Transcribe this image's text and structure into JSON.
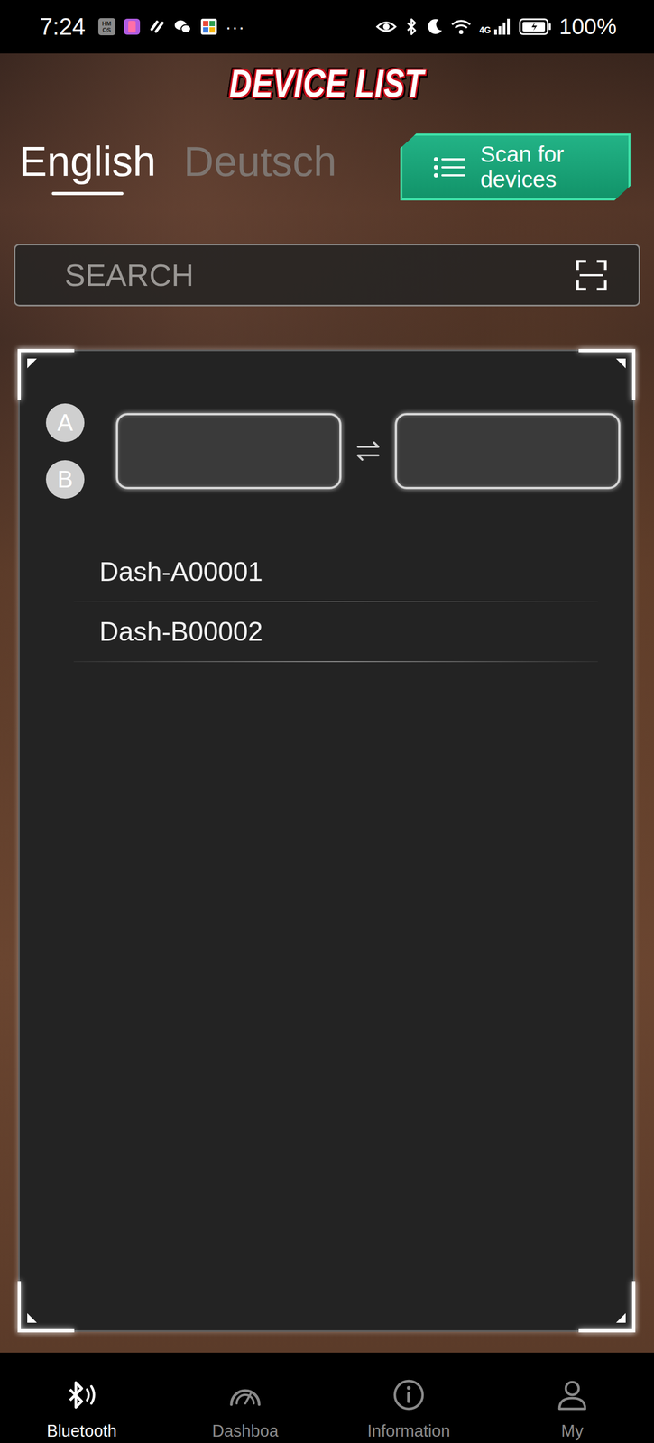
{
  "status_bar": {
    "time": "7:24",
    "hm_badge": "HM OS",
    "more": "···",
    "network": "4G",
    "battery": "100%"
  },
  "header": {
    "title": "DEVICE LIST"
  },
  "languages": [
    {
      "label": "English",
      "selected": true
    },
    {
      "label": "Deutsch",
      "selected": false
    }
  ],
  "scan_button": {
    "label": "Scan for devices"
  },
  "search": {
    "placeholder": "SEARCH"
  },
  "slot_badges": [
    {
      "label": "A"
    },
    {
      "label": "B"
    }
  ],
  "devices": [
    {
      "name": "Dash-A00001"
    },
    {
      "name": "Dash-B00002"
    }
  ],
  "nav": [
    {
      "label": "Bluetooth",
      "kind": "bluetooth",
      "selected": true
    },
    {
      "label": "Dashboa",
      "kind": "dashboard",
      "selected": false
    },
    {
      "label": "Information",
      "kind": "info",
      "selected": false
    },
    {
      "label": "My",
      "kind": "user",
      "selected": false
    }
  ]
}
